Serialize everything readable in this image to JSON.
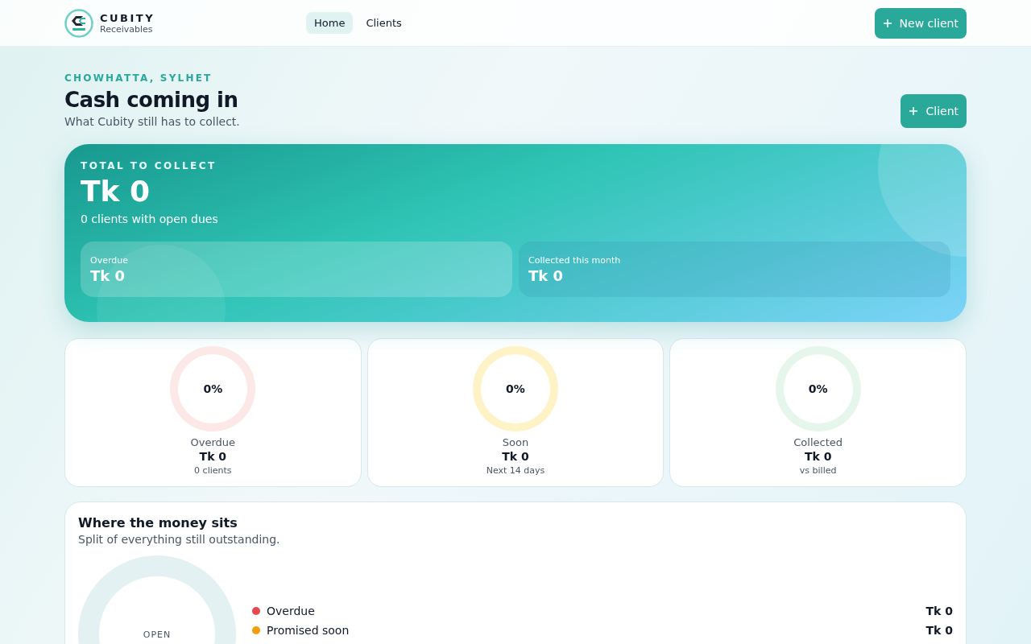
{
  "brand": {
    "name": "CUBITY",
    "tagline": "Receivables"
  },
  "nav": [
    {
      "label": "Home",
      "selected": true
    },
    {
      "label": "Clients",
      "selected": false
    }
  ],
  "header_button": "New client",
  "page": {
    "eyebrow": "CHOWHATTA, SYLHET",
    "title": "Cash coming in",
    "subtitle": "What Cubity still has to collect.",
    "button": "Client"
  },
  "hero": {
    "label": "TOTAL TO COLLECT",
    "amount": "Tk 0",
    "note": "0 clients with open dues",
    "tiles": [
      {
        "label": "Overdue",
        "value": "Tk 0"
      },
      {
        "label": "Collected this month",
        "value": "Tk 0"
      }
    ]
  },
  "stats": [
    {
      "percent": "0%",
      "level": 0,
      "color": "#fde8e8",
      "label": "Overdue",
      "value": "Tk 0",
      "note": "0 clients"
    },
    {
      "percent": "0%",
      "level": 0,
      "color": "#fef3c7",
      "label": "Soon",
      "value": "Tk 0",
      "note": "Next 14 days"
    },
    {
      "percent": "0%",
      "level": 0,
      "color": "#e6f6ec",
      "label": "Collected",
      "value": "Tk 0",
      "note": "vs billed"
    }
  ],
  "split": {
    "title": "Where the money sits",
    "subtitle": "Split of everything still outstanding.",
    "center_label": "OPEN",
    "legend": [
      {
        "label": "Overdue",
        "value": "Tk 0",
        "color": "#e5484d"
      },
      {
        "label": "Promised soon",
        "value": "Tk 0",
        "color": "#f59e0b"
      }
    ]
  }
}
